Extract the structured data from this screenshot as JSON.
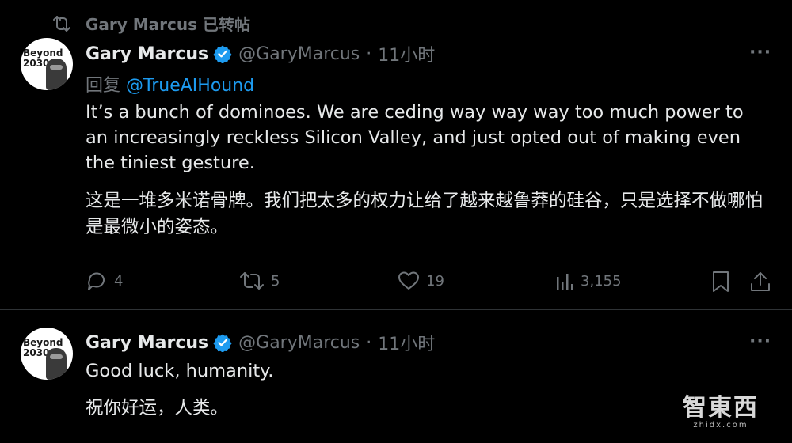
{
  "repost_header": {
    "text": "Gary Marcus 已转帖"
  },
  "tweets": [
    {
      "avatar_text": "Beyond 2030",
      "name": "Gary Marcus",
      "handle": "@GaryMarcus",
      "time_sep": "·",
      "time": "11小时",
      "more": "···",
      "reply_prefix": "回复",
      "reply_to": "@TrueAIHound",
      "text_en": "It’s a bunch of dominoes. We are ceding way way way too much power to an increasingly reckless Silicon Valley, and just opted out of making even the tiniest gesture.",
      "text_zh": "这是一堆多米诺骨牌。我们把太多的权力让给了越来越鲁莽的硅谷，只是选择不做哪怕是最微小的姿态。",
      "replies": "4",
      "reposts": "5",
      "likes": "19",
      "views": "3,155"
    },
    {
      "avatar_text": "Beyond 2030",
      "name": "Gary Marcus",
      "handle": "@GaryMarcus",
      "time_sep": "·",
      "time": "11小时",
      "more": "···",
      "text_en": "Good luck, humanity.",
      "text_zh": "祝你好运，人类。"
    }
  ],
  "watermark": {
    "main": "智東西",
    "sub": "zhidx.com"
  },
  "colors": {
    "background": "#000000",
    "text": "#e7e9ea",
    "muted": "#71767b",
    "link": "#1d9bf0",
    "verified": "#1d9bf0"
  },
  "icons": [
    "repost-icon",
    "verified-badge-icon",
    "more-icon",
    "reply-icon",
    "like-icon",
    "views-icon",
    "bookmark-icon",
    "share-icon"
  ]
}
